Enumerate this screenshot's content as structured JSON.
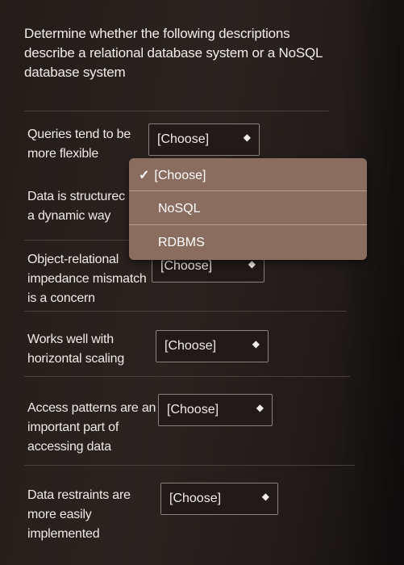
{
  "question": "Determine whether the following descriptions describe a relational database system or a NoSQL database system",
  "rows": [
    {
      "label": "Queries tend to be more flexible",
      "selected": "[Choose]"
    },
    {
      "label": "Data is structured in a dynamic way",
      "label_visible_line1": "Data is structurec",
      "label_visible_line2": "a dynamic way",
      "selected": ""
    },
    {
      "label": "Object-relational impedance mismatch is a concern",
      "selected": "[Choose]"
    },
    {
      "label": "Works well with horizontal scaling",
      "selected": "[Choose]"
    },
    {
      "label": "Access patterns are an important part of accessing data",
      "selected": "[Choose]"
    },
    {
      "label": "Data restraints are more easily implemented",
      "selected": "[Choose]"
    }
  ],
  "dropdown": {
    "options": [
      "[Choose]",
      "NoSQL",
      "RDBMS"
    ],
    "checked_option": "[Choose]"
  },
  "icons": {
    "select_arrow": "updown-chevron-icon",
    "check": "checkmark-icon"
  },
  "colors": {
    "background": "#2b2320",
    "dropdown_bg": "#8b6d5f",
    "text": "#f0ebe7"
  }
}
